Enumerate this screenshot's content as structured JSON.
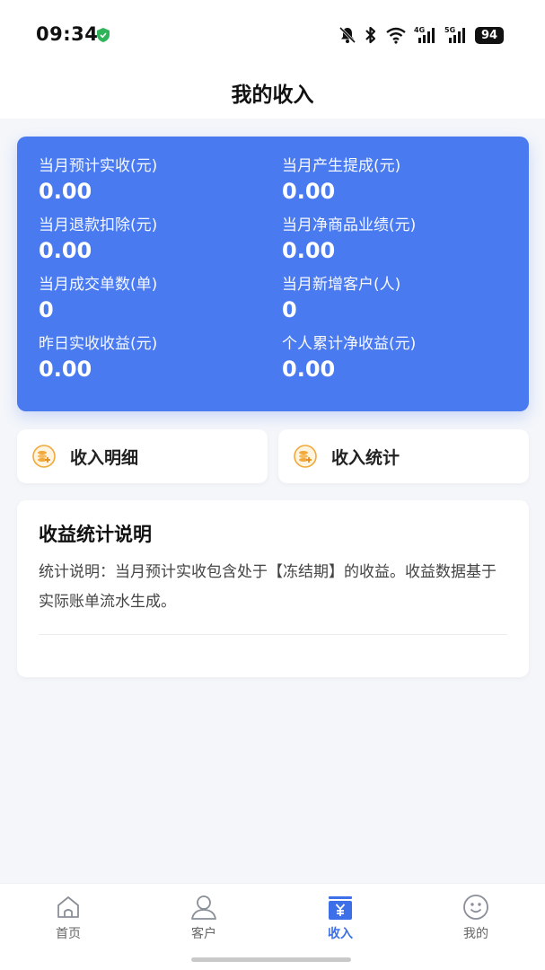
{
  "status_bar": {
    "time": "09:34",
    "network_4g": "4G",
    "network_5g": "5G",
    "battery": "94",
    "icons": [
      "shield-icon",
      "mute-bell-icon",
      "bluetooth-icon",
      "wifi-icon",
      "signal-icon",
      "signal-icon",
      "battery-icon"
    ]
  },
  "header": {
    "title": "我的收入"
  },
  "summary": {
    "color": "#4a7af0",
    "stats": [
      {
        "label": "当月预计实收(元)",
        "value": "0.00"
      },
      {
        "label": "当月产生提成(元)",
        "value": "0.00"
      },
      {
        "label": "当月退款扣除(元)",
        "value": "0.00"
      },
      {
        "label": "当月净商品业绩(元)",
        "value": "0.00"
      },
      {
        "label": "当月成交单数(单)",
        "value": "0"
      },
      {
        "label": "当月新增客户(人)",
        "value": "0"
      },
      {
        "label": "昨日实收收益(元)",
        "value": "0.00"
      },
      {
        "label": "个人累计净收益(元)",
        "value": "0.00"
      }
    ]
  },
  "actions": [
    {
      "label": "收入明细",
      "icon": "coin-stack-icon"
    },
    {
      "label": "收入统计",
      "icon": "coin-stack-icon"
    }
  ],
  "explanation": {
    "title": "收益统计说明",
    "text": "统计说明：当月预计实收包含处于【冻结期】的收益。收益数据基于实际账单流水生成。"
  },
  "bottom_nav": {
    "active_color": "#3d6fe8",
    "items": [
      {
        "label": "首页",
        "icon": "home-icon"
      },
      {
        "label": "客户",
        "icon": "person-icon"
      },
      {
        "label": "收入",
        "icon": "yuan-wallet-icon"
      },
      {
        "label": "我的",
        "icon": "smile-face-icon"
      }
    ]
  }
}
